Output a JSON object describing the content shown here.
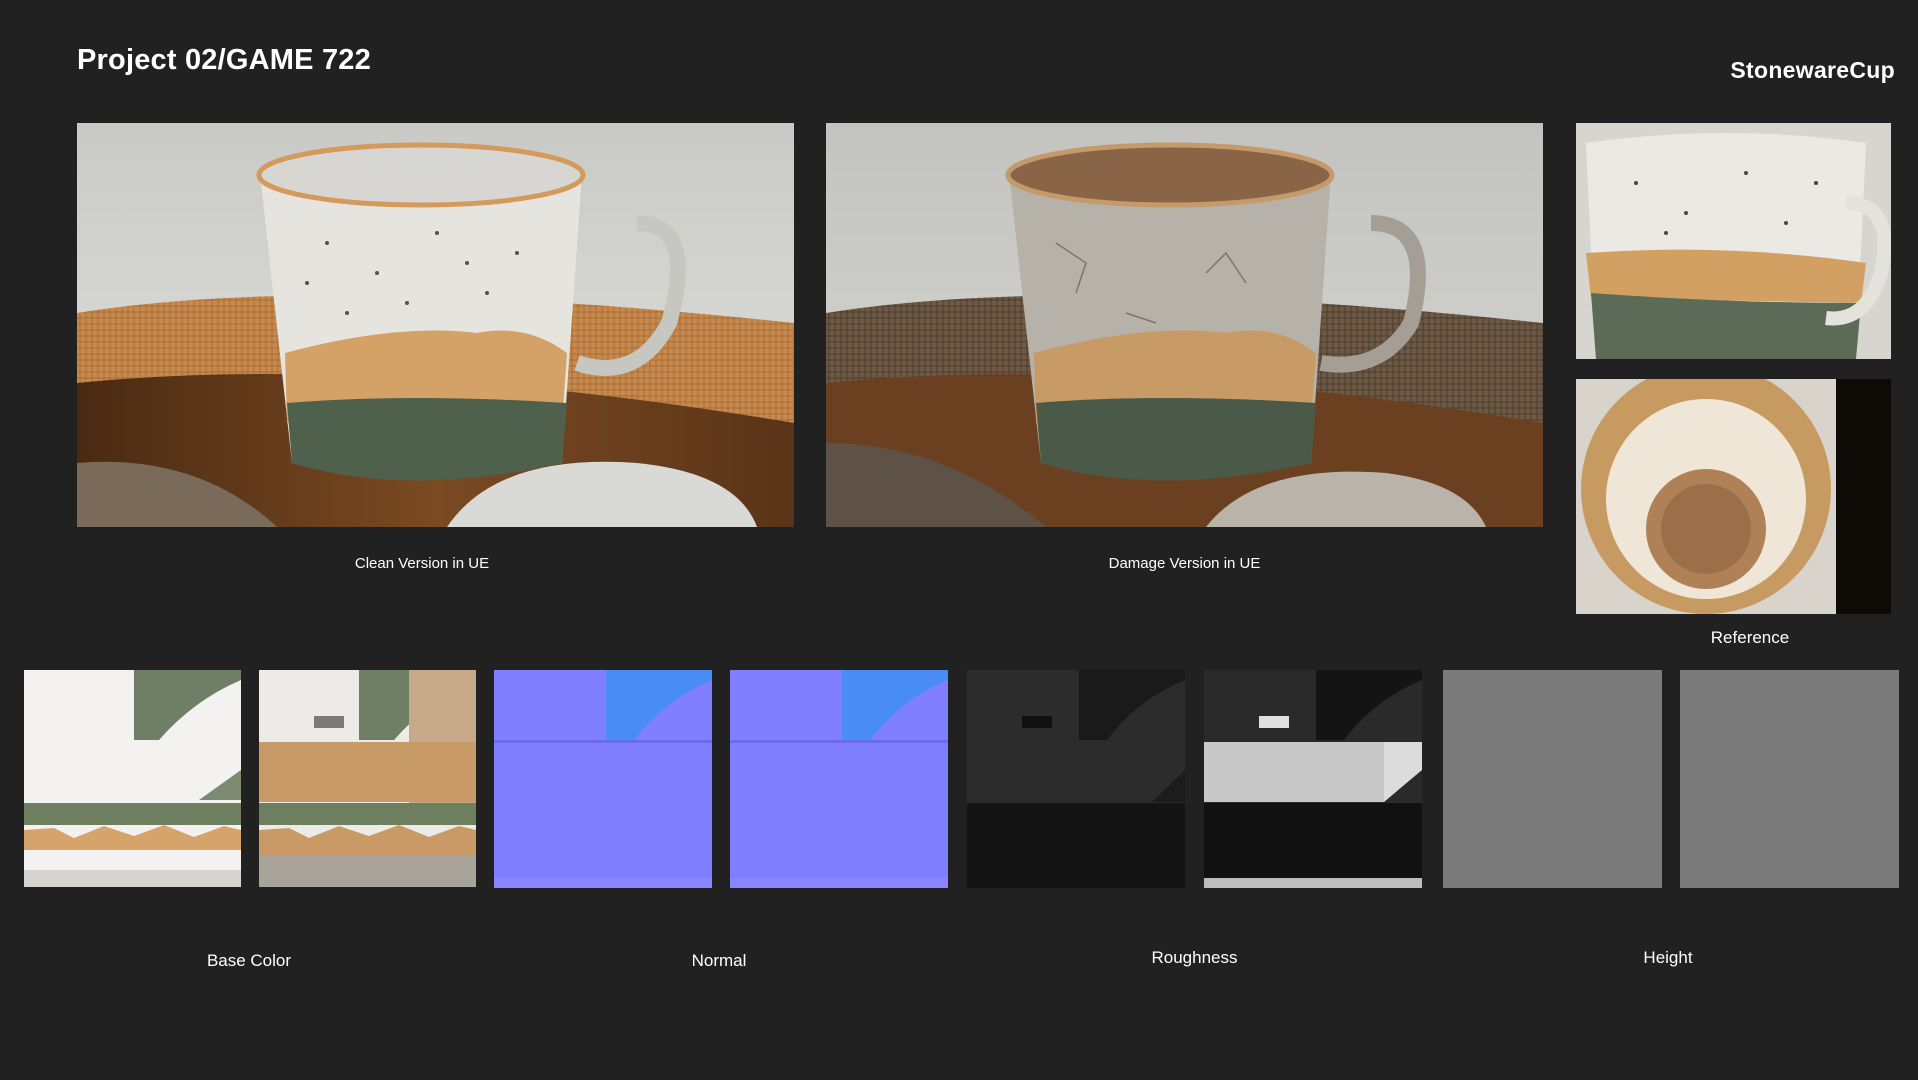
{
  "header": {
    "title": "Project 02/GAME 722",
    "asset_name": "StonewareCup"
  },
  "renders": [
    {
      "caption": "Clean Version in UE"
    },
    {
      "caption": "Damage Version in UE"
    }
  ],
  "reference": {
    "caption": "Reference"
  },
  "texture_maps": [
    {
      "caption": "Base Color"
    },
    {
      "caption": "Normal"
    },
    {
      "caption": "Roughness"
    },
    {
      "caption": "Height"
    }
  ],
  "colors": {
    "background": "#212121",
    "normal_map": "#7f7fff",
    "height_map": "#7b7b7b",
    "glaze_white": "#e8e6e2",
    "clay_tan": "#d6a46a",
    "glaze_green": "#556650",
    "wood": "#6b3e1e"
  }
}
